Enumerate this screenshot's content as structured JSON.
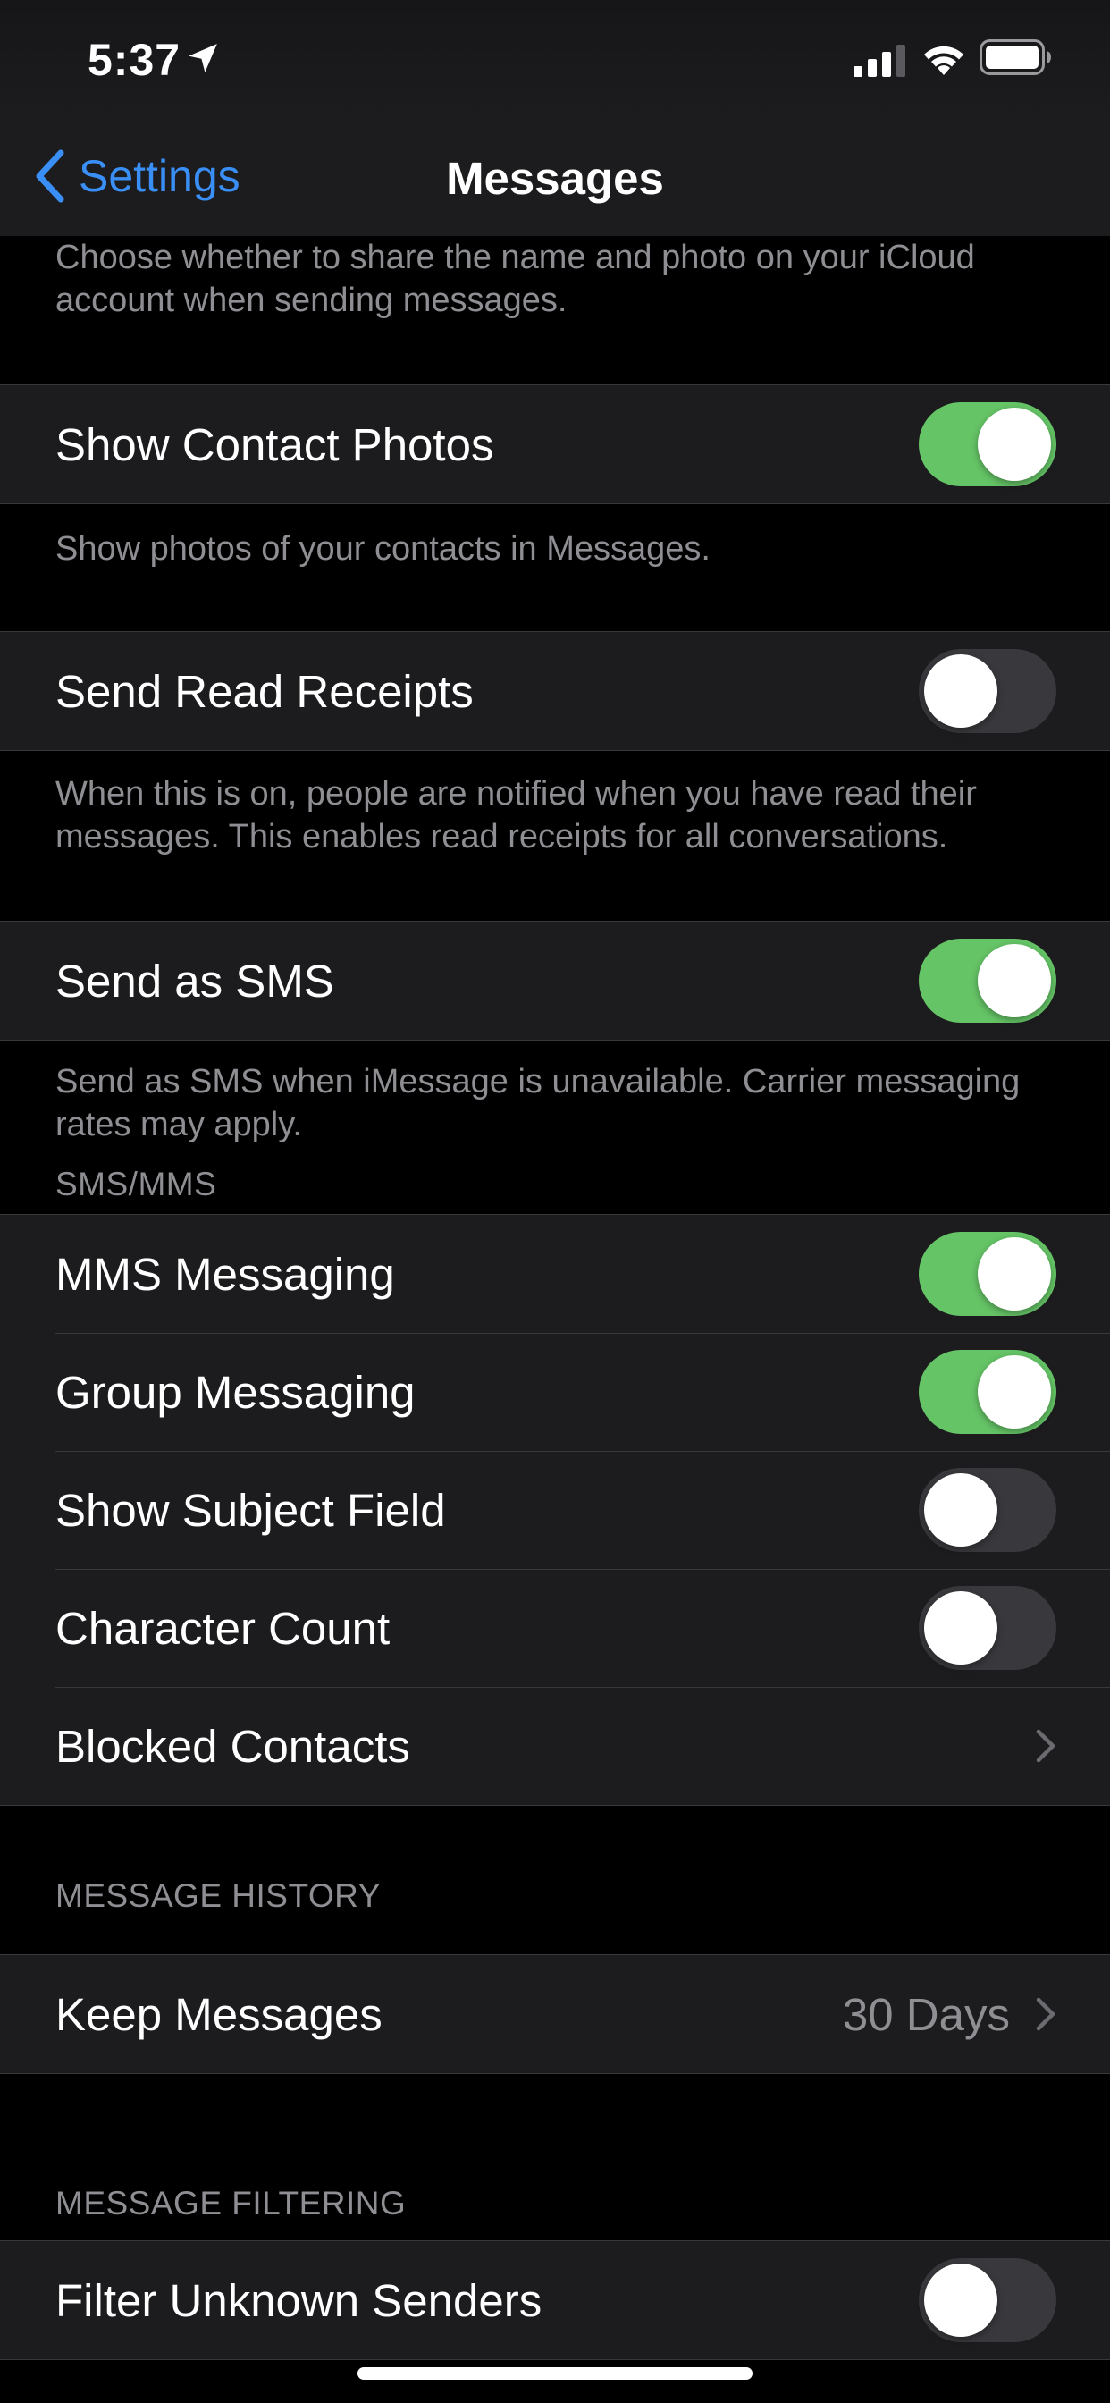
{
  "status_bar": {
    "time": "5:37",
    "icons": [
      "location-arrow-icon",
      "cellular-signal-icon",
      "wifi-icon",
      "battery-icon"
    ]
  },
  "nav": {
    "back_label": "Settings",
    "title": "Messages"
  },
  "sections": {
    "top_footer": "Choose whether to share the name and photo on your iCloud account when sending messages.",
    "show_contact_photos": {
      "label": "Show Contact Photos",
      "on": true,
      "footer": "Show photos of your contacts in Messages."
    },
    "send_read_receipts": {
      "label": "Send Read Receipts",
      "on": false,
      "footer": "When this is on, people are notified when you have read their messages. This enables read receipts for all conversations."
    },
    "send_as_sms": {
      "label": "Send as SMS",
      "on": true,
      "footer": "Send as SMS when iMessage is unavailable. Carrier messaging rates may apply."
    },
    "sms_mms": {
      "header": "SMS/MMS",
      "rows": [
        {
          "label": "MMS Messaging",
          "on": true
        },
        {
          "label": "Group Messaging",
          "on": true
        },
        {
          "label": "Show Subject Field",
          "on": false
        },
        {
          "label": "Character Count",
          "on": false
        }
      ],
      "blocked_contacts_label": "Blocked Contacts"
    },
    "message_history": {
      "header": "MESSAGE HISTORY",
      "keep_messages_label": "Keep Messages",
      "keep_messages_value": "30 Days"
    },
    "message_filtering": {
      "header": "MESSAGE FILTERING",
      "filter_unknown_label": "Filter Unknown Senders",
      "filter_unknown_on": false
    }
  },
  "colors": {
    "accent_blue": "#3a8ff7",
    "toggle_on": "#65c466",
    "toggle_off": "#39393d",
    "cell_background": "#1c1c1e",
    "secondary_text": "#8e8e93"
  }
}
